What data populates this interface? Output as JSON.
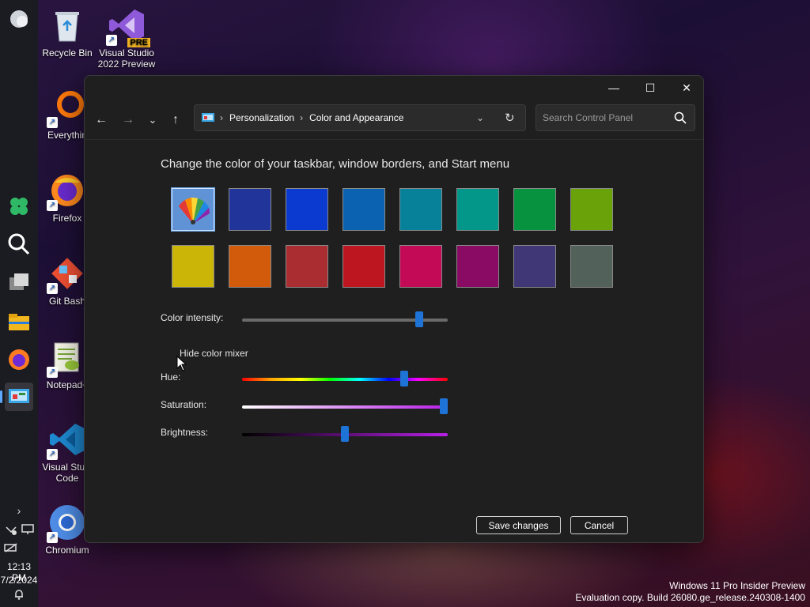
{
  "desktop": {
    "icons": [
      {
        "label": "Recycle Bin",
        "icon": "recycle-bin-icon"
      },
      {
        "label": "Visual Studio 2022 Preview",
        "icon": "visual-studio-icon",
        "badge": "PRE"
      },
      {
        "label": "Everythin",
        "icon": "everything-search-icon"
      },
      {
        "label": "Firefox",
        "icon": "firefox-icon"
      },
      {
        "label": "Git Bash",
        "icon": "git-bash-icon"
      },
      {
        "label": "Notepad+",
        "icon": "notepad-plus-icon"
      },
      {
        "label": "Visual Studi Code",
        "icon": "vscode-icon"
      },
      {
        "label": "Chromium",
        "icon": "chromium-icon"
      }
    ]
  },
  "taskbar": {
    "clock_time": "12:13 PM",
    "clock_date": "7/2/2024",
    "expand_glyph": "›"
  },
  "window": {
    "titlebar": {
      "minimize_glyph": "—",
      "maximize_glyph": "☐",
      "close_glyph": "✕"
    },
    "nav": {
      "back_glyph": "←",
      "forward_glyph": "→",
      "recent_glyph": "⌄",
      "up_glyph": "↑"
    },
    "breadcrumb": {
      "sep1": "›",
      "item1": "Personalization",
      "sep2": "›",
      "item2": "Color and Appearance",
      "dropdown_glyph": "⌄",
      "refresh_glyph": "↻"
    },
    "search": {
      "placeholder": "Search Control Panel",
      "value": ""
    },
    "heading": "Change the color of your taskbar, window borders, and Start menu",
    "swatches": [
      {
        "color": "#custom",
        "name": "automatic"
      },
      {
        "color": "#20349a",
        "name": "navy"
      },
      {
        "color": "#0a3ad0",
        "name": "blue"
      },
      {
        "color": "#0a62b0",
        "name": "cobalt"
      },
      {
        "color": "#07809a",
        "name": "teal-blue"
      },
      {
        "color": "#03978a",
        "name": "teal"
      },
      {
        "color": "#06923f",
        "name": "green"
      },
      {
        "color": "#6aa20a",
        "name": "lime"
      },
      {
        "color": "#cbb507",
        "name": "yellow"
      },
      {
        "color": "#d15a0b",
        "name": "orange"
      },
      {
        "color": "#a92d31",
        "name": "brick"
      },
      {
        "color": "#bd1620",
        "name": "red"
      },
      {
        "color": "#c20a56",
        "name": "magenta"
      },
      {
        "color": "#8a0b63",
        "name": "purple"
      },
      {
        "color": "#3f3776",
        "name": "indigo"
      },
      {
        "color": "#52625a",
        "name": "slate"
      }
    ],
    "color_intensity": {
      "label": "Color intensity:",
      "value_pct": 86
    },
    "mixer_toggle": "Hide color mixer",
    "hue": {
      "label": "Hue:",
      "value_pct": 79
    },
    "saturation": {
      "label": "Saturation:",
      "value_pct": 98
    },
    "brightness": {
      "label": "Brightness:",
      "value_pct": 50
    },
    "buttons": {
      "save": "Save changes",
      "cancel": "Cancel"
    }
  },
  "watermark": {
    "line1": "Windows 11 Pro Insider Preview",
    "line2": "Evaluation copy. Build 26080.ge_release.240308-1400"
  }
}
